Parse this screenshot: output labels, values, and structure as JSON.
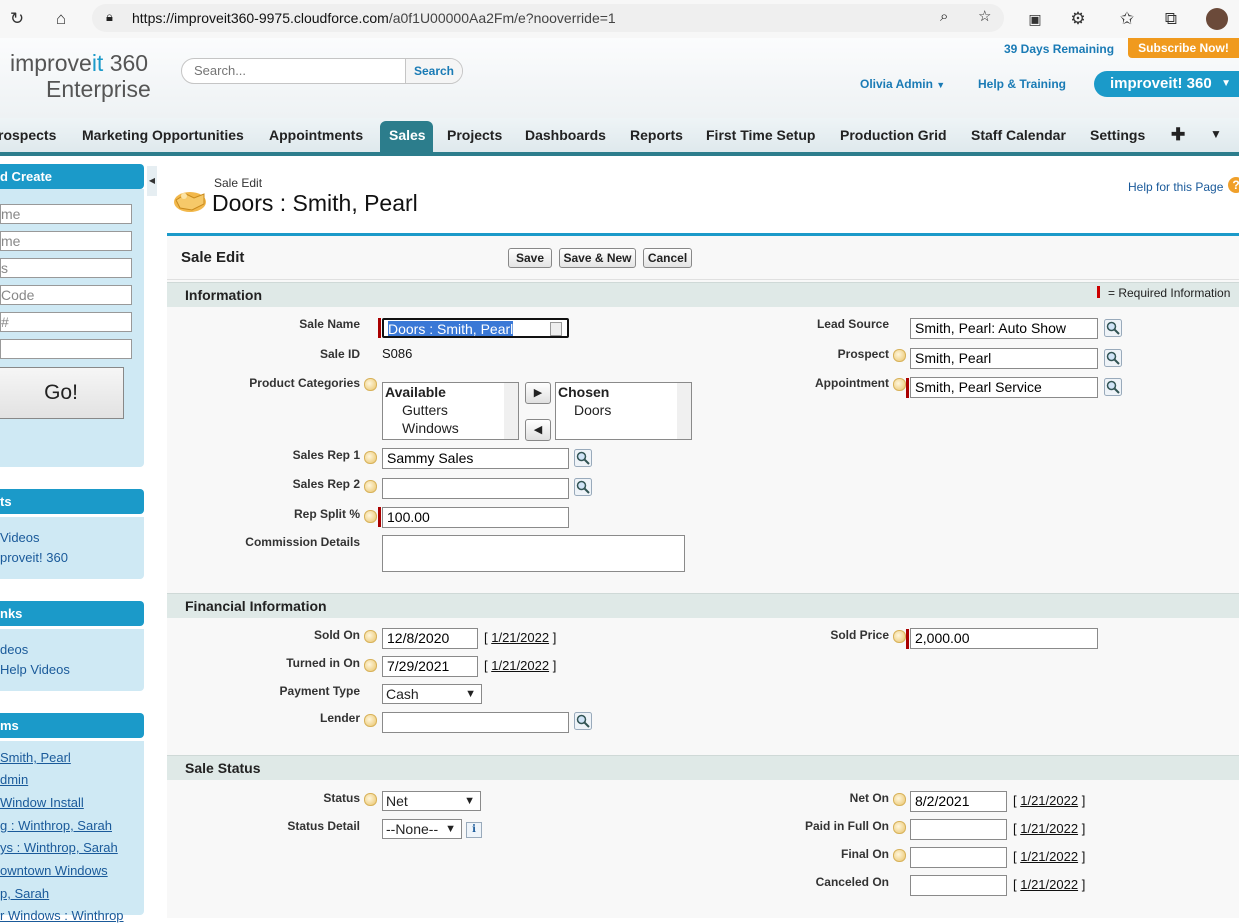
{
  "browser": {
    "url_domain": "https://improveit360-9975.cloudforce.com",
    "url_path": "/a0f1U00000Aa2Fm/e?nooverride=1"
  },
  "header": {
    "logo_line1_a": "improve",
    "logo_line1_b": "it",
    "logo_line1_c": " 360",
    "logo_line2": "Enterprise",
    "search_placeholder": "Search...",
    "search_button": "Search",
    "days_remaining": "39 Days Remaining",
    "subscribe": "Subscribe Now!",
    "user_menu": "Olivia Admin",
    "help_training": "Help & Training",
    "app_menu": "improveit! 360"
  },
  "tabs": [
    "rospects",
    "Marketing Opportunities",
    "Appointments",
    "Sales",
    "Projects",
    "Dashboards",
    "Reports",
    "First Time Setup",
    "Production Grid",
    "Staff Calendar",
    "Settings"
  ],
  "active_tab": "Sales",
  "sidebar": {
    "quick_create": "d Create",
    "inputs": [
      "me",
      "me",
      "s",
      "Code",
      "#",
      ""
    ],
    "go": "Go!",
    "section2": "ts",
    "section2_links": [
      "Videos",
      "proveit! 360"
    ],
    "section3": "nks",
    "section3_links": [
      "deos",
      "Help Videos"
    ],
    "section4": "ms",
    "section4_links": [
      " Smith, Pearl",
      "dmin",
      "Window Install",
      "g : Winthrop, Sarah",
      "ys : Winthrop, Sarah",
      "owntown Windows",
      "p, Sarah",
      "r Windows : Winthrop"
    ]
  },
  "page": {
    "crumb": "Sale Edit",
    "title": "Doors : Smith, Pearl",
    "help_link": "Help for this Page",
    "edit_title": "Sale Edit",
    "buttons": {
      "save": "Save",
      "save_new": "Save & New",
      "cancel": "Cancel"
    },
    "required_info": "= Required Information"
  },
  "information": {
    "heading": "Information",
    "sale_name_label": "Sale Name",
    "sale_name": "Doors : Smith, Pearl",
    "sale_id_label": "Sale ID",
    "sale_id": "S086",
    "product_categories_label": "Product Categories",
    "available_label": "Available",
    "available": [
      "Gutters",
      "Windows"
    ],
    "chosen_label": "Chosen",
    "chosen": [
      "Doors"
    ],
    "sales_rep1_label": "Sales Rep 1",
    "sales_rep1": "Sammy Sales",
    "sales_rep2_label": "Sales Rep 2",
    "sales_rep2": "",
    "rep_split_label": "Rep Split %",
    "rep_split": "100.00",
    "commission_label": "Commission Details",
    "commission": "",
    "lead_source_label": "Lead Source",
    "lead_source": "Smith, Pearl: Auto Show",
    "prospect_label": "Prospect",
    "prospect": "Smith, Pearl",
    "appointment_label": "Appointment",
    "appointment": "Smith, Pearl Service"
  },
  "financial": {
    "heading": "Financial Information",
    "sold_on_label": "Sold On",
    "sold_on": "12/8/2020",
    "turned_in_label": "Turned in On",
    "turned_in": "7/29/2021",
    "today": "1/21/2022",
    "payment_type_label": "Payment Type",
    "payment_type": "Cash",
    "lender_label": "Lender",
    "lender": "",
    "sold_price_label": "Sold Price",
    "sold_price": "2,000.00"
  },
  "status": {
    "heading": "Sale Status",
    "status_label": "Status",
    "status": "Net",
    "status_detail_label": "Status Detail",
    "status_detail": "--None--",
    "net_on_label": "Net On",
    "net_on": "8/2/2021",
    "paid_label": "Paid in Full On",
    "paid": "",
    "final_label": "Final On",
    "final": "",
    "canceled_label": "Canceled On",
    "canceled": ""
  }
}
